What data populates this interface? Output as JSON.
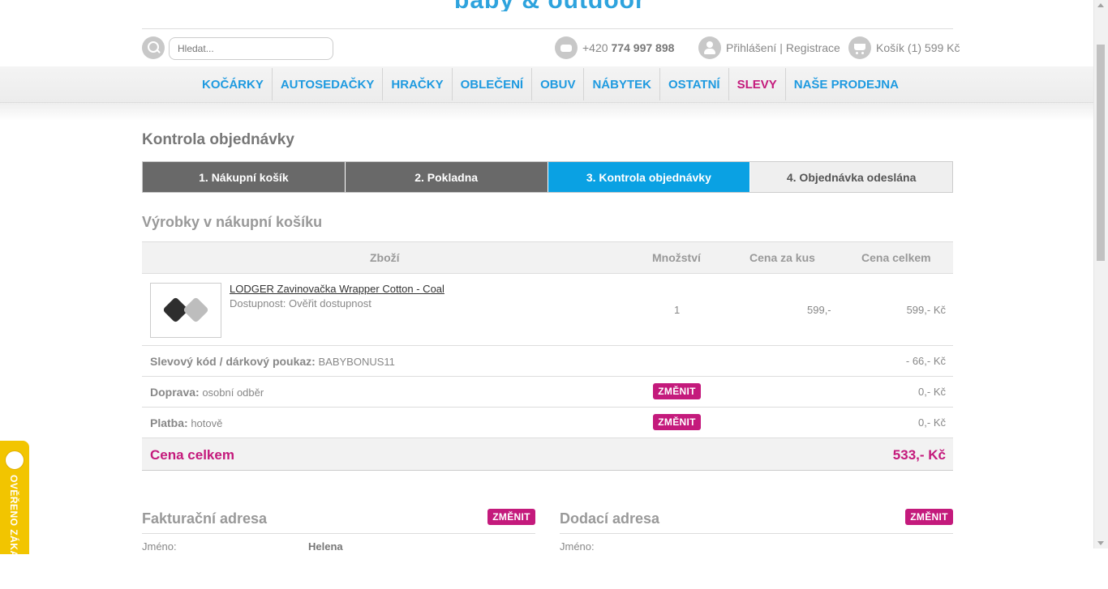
{
  "logo": {
    "text": "baby & outdoor"
  },
  "header": {
    "search_placeholder": "Hledat...",
    "phone_prefix": "+420",
    "phone_number": "774 997 898",
    "login": "Přihlášení",
    "separator": "|",
    "register": "Registrace",
    "cart": "Košík (1) 599 Kč"
  },
  "nav": {
    "items": [
      "KOČÁRKY",
      "AUTOSEDAČKY",
      "HRAČKY",
      "OBLEČENÍ",
      "OBUV",
      "NÁBYTEK",
      "OSTATNÍ",
      "SLEVY",
      "NAŠE PRODEJNA"
    ],
    "sale_color": "#c41a7c",
    "link_color": "#1e9ae0"
  },
  "page": {
    "title": "Kontrola objednávky"
  },
  "steps": [
    {
      "label": "1. Nákupní košík",
      "state": "done"
    },
    {
      "label": "2. Pokladna",
      "state": "done"
    },
    {
      "label": "3. Kontrola objednávky",
      "state": "active"
    },
    {
      "label": "4. Objednávka odeslána",
      "state": "pending"
    }
  ],
  "cart": {
    "section_title": "Výrobky v nákupní košíku",
    "headers": {
      "product": "Zboží",
      "quantity": "Množství",
      "unit_price": "Cena za kus",
      "total": "Cena celkem"
    },
    "product": {
      "name": "LODGER Zavinovačka Wrapper Cotton - Coal",
      "availability": "Dostupnost: Ověřit dostupnost",
      "quantity": "1",
      "unit_price": "599,-",
      "total": "599,- Kč"
    },
    "discount": {
      "label": "Slevový kód / dárkový poukaz:",
      "value": "BABYBONUS11",
      "amount": "- 66,- Kč"
    },
    "shipping": {
      "label": "Doprava:",
      "value": "osobní odběr",
      "amount": "0,- Kč"
    },
    "payment": {
      "label": "Platba:",
      "value": "hotově",
      "amount": "0,- Kč"
    },
    "change_label": "ZMĚNIT",
    "grand_total": {
      "label": "Cena celkem",
      "amount": "533,- Kč"
    }
  },
  "billing": {
    "title": "Fakturační adresa",
    "field": "Jméno:",
    "value": "Helena"
  },
  "delivery": {
    "title": "Dodací adresa",
    "field": "Jméno:"
  },
  "badge": {
    "text": "OVĚŘENO ZÁKAZNÍKY"
  },
  "colors": {
    "accent_blue": "#0aa1e3",
    "accent_pink": "#c41a7c",
    "step_done": "#696969"
  }
}
